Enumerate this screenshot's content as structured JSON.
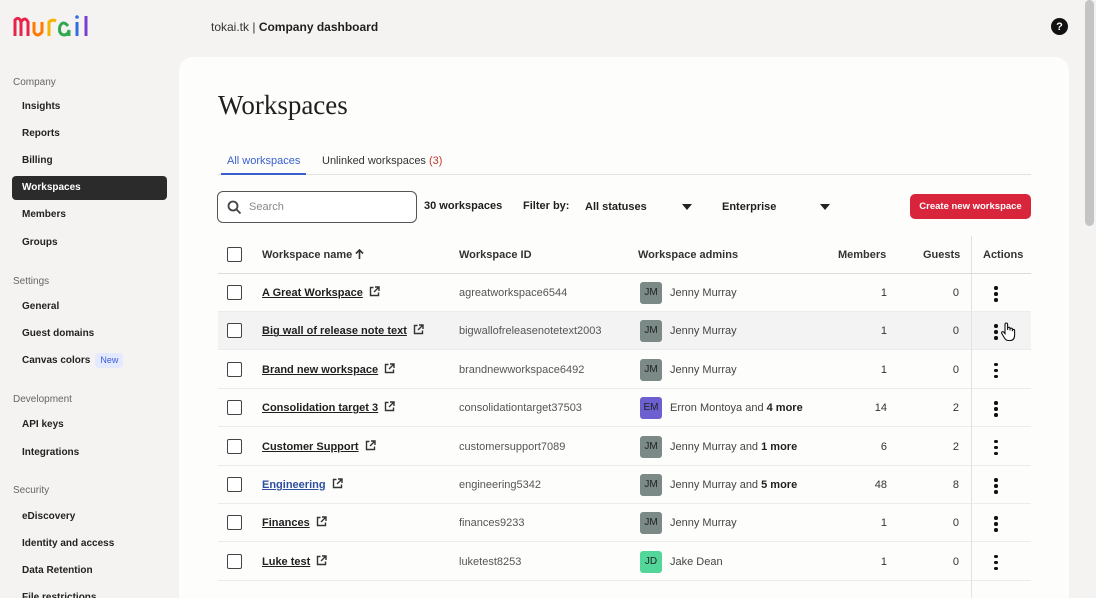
{
  "topbar": {
    "domain": "tokai.tk",
    "separator": " | ",
    "title": "Company dashboard",
    "help_label": "?"
  },
  "sidebar": {
    "sections": [
      {
        "title": "Company",
        "items": [
          {
            "label": "Insights"
          },
          {
            "label": "Reports"
          },
          {
            "label": "Billing"
          },
          {
            "label": "Workspaces",
            "active": true
          },
          {
            "label": "Members"
          },
          {
            "label": "Groups"
          }
        ]
      },
      {
        "title": "Settings",
        "items": [
          {
            "label": "General"
          },
          {
            "label": "Guest domains"
          },
          {
            "label": "Canvas colors",
            "badge": "New"
          }
        ]
      },
      {
        "title": "Development",
        "items": [
          {
            "label": "API keys"
          },
          {
            "label": "Integrations"
          }
        ]
      },
      {
        "title": "Security",
        "items": [
          {
            "label": "eDiscovery"
          },
          {
            "label": "Identity and access"
          },
          {
            "label": "Data Retention"
          },
          {
            "label": "File restrictions"
          }
        ]
      }
    ]
  },
  "main": {
    "title": "Workspaces",
    "tabs": [
      {
        "label": "All workspaces",
        "active": true
      },
      {
        "label": "Unlinked workspaces",
        "count": "(3)"
      }
    ],
    "search": {
      "placeholder": "Search"
    },
    "workspace_count": "30 workspaces",
    "filter_label": "Filter by:",
    "status_filter": "All statuses",
    "plan_filter": "Enterprise",
    "create_button": "Create new workspace"
  },
  "table": {
    "headers": {
      "name": "Workspace name",
      "id": "Workspace ID",
      "admins": "Workspace admins",
      "members": "Members",
      "guests": "Guests",
      "actions": "Actions"
    },
    "rows": [
      {
        "name": "A Great Workspace",
        "id": "agreatworkspace6544",
        "initials": "JM",
        "admin": "Jenny Murray",
        "more": "",
        "members": "1",
        "guests": "0"
      },
      {
        "name": "Big wall of release note text",
        "id": "bigwallofreleasenotetext2003",
        "initials": "JM",
        "admin": "Jenny Murray",
        "more": "",
        "members": "1",
        "guests": "0"
      },
      {
        "name": "Brand new workspace",
        "id": "brandnewworkspace6492",
        "initials": "JM",
        "admin": "Jenny Murray",
        "more": "",
        "members": "1",
        "guests": "0"
      },
      {
        "name": "Consolidation target 3",
        "id": "consolidationtarget37503",
        "initials": "EM",
        "admin": "Erron Montoya",
        "more": "4 more",
        "members": "14",
        "guests": "2"
      },
      {
        "name": "Customer Support",
        "id": "customersupport7089",
        "initials": "JM",
        "admin": "Jenny Murray",
        "more": "1 more",
        "members": "6",
        "guests": "2"
      },
      {
        "name": "Engineering",
        "id": "engineering5342",
        "initials": "JM",
        "admin": "Jenny Murray",
        "more": "5 more",
        "members": "48",
        "guests": "8"
      },
      {
        "name": "Finances",
        "id": "finances9233",
        "initials": "JM",
        "admin": "Jenny Murray",
        "more": "",
        "members": "1",
        "guests": "0"
      },
      {
        "name": "Luke test",
        "id": "luketest8253",
        "initials": "JD",
        "admin": "Jake Dean",
        "more": "",
        "members": "1",
        "guests": "0"
      }
    ],
    "and_label": " and "
  },
  "colors": {
    "accent": "#3a5fcd",
    "create_button": "#d9253b",
    "avatar_jm": "#7b8a86",
    "avatar_em": "#6c5fd0",
    "avatar_jd": "#52d69a"
  }
}
